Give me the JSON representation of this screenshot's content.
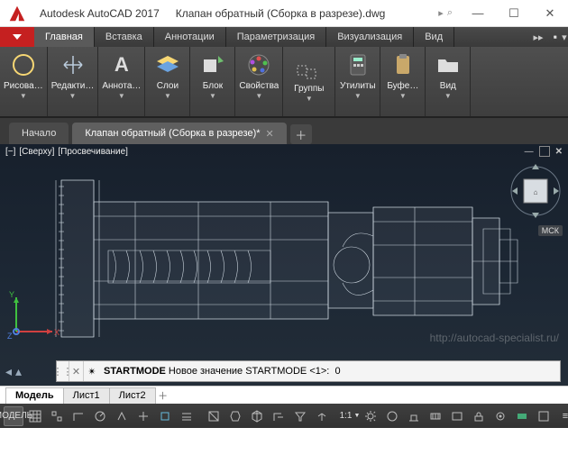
{
  "window": {
    "app_title": "Autodesk AutoCAD 2017",
    "file_name": "Клапан обратный (Сборка в разрезе).dwg"
  },
  "menu": {
    "tabs": [
      "Главная",
      "Вставка",
      "Аннотации",
      "Параметризация",
      "Визуализация",
      "Вид"
    ],
    "active_index": 0
  },
  "ribbon": {
    "panels": [
      {
        "label": "Рисова…",
        "icon": "circle"
      },
      {
        "label": "Редакти…",
        "icon": "move"
      },
      {
        "label": "Аннота…",
        "icon": "text-a"
      },
      {
        "label": "Слои",
        "icon": "layers"
      },
      {
        "label": "Блок",
        "icon": "block"
      },
      {
        "label": "Свойства",
        "icon": "palette"
      },
      {
        "label": "Группы",
        "icon": "groups",
        "top": true
      },
      {
        "label": "Утилиты",
        "icon": "calc"
      },
      {
        "label": "Буфе…",
        "icon": "clipboard"
      },
      {
        "label": "Вид",
        "icon": "folder-open"
      }
    ]
  },
  "doc_tabs": {
    "items": [
      {
        "label": "Начало",
        "active": false
      },
      {
        "label": "Клапан обратный (Сборка в разрезе)*",
        "active": true
      }
    ]
  },
  "viewport": {
    "minus": "[−]",
    "view": "[Сверху]",
    "style": "[Просвечивание]",
    "wcs": "МСК",
    "ucs": {
      "x": "X",
      "y": "Y",
      "z": "Z"
    }
  },
  "watermark": "http://autocad-specialist.ru/",
  "command": {
    "text": "STARTMODE Новое значение STARTMODE <1>:  0",
    "prefix_bold": "STARTMODE"
  },
  "layout_tabs": {
    "items": [
      "Модель",
      "Лист1",
      "Лист2"
    ],
    "active_index": 0
  },
  "statusbar": {
    "model_label": "МОДЕЛЬ",
    "scale_label": "1:1"
  }
}
